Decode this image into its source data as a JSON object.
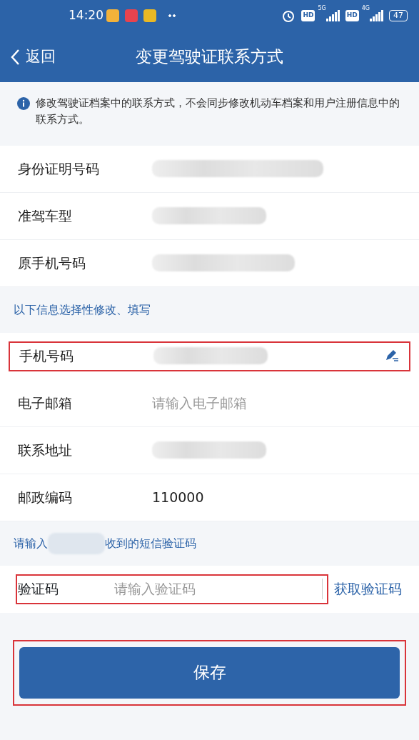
{
  "status_bar": {
    "time": "14:20",
    "hd_badges": [
      "HD",
      "HD"
    ],
    "networks": [
      "5G",
      "4G"
    ],
    "battery": "47"
  },
  "header": {
    "back_label": "返回",
    "title": "变更驾驶证联系方式"
  },
  "notice": "修改驾驶证档案中的联系方式，不会同步修改机动车档案和用户注册信息中的联系方式。",
  "info_rows": [
    {
      "label": "身份证明号码",
      "kind": "redacted",
      "highlighted": false
    },
    {
      "label": "准驾车型",
      "kind": "redacted",
      "highlighted": false
    },
    {
      "label": "原手机号码",
      "kind": "redacted",
      "highlighted": false
    }
  ],
  "section_label": "以下信息选择性修改、填写",
  "edit_rows": [
    {
      "label": "手机号码",
      "kind": "redacted",
      "highlighted": true,
      "editable": true
    },
    {
      "label": "电子邮箱",
      "kind": "input",
      "placeholder": "请输入电子邮箱",
      "highlighted": false,
      "editable": false
    },
    {
      "label": "联系地址",
      "kind": "redacted",
      "highlighted": false,
      "editable": false
    },
    {
      "label": "邮政编码",
      "kind": "text",
      "value": "110000",
      "highlighted": false,
      "editable": false
    }
  ],
  "sms_hint": {
    "prefix": "请输入",
    "suffix": "收到的短信验证码"
  },
  "code_row": {
    "label": "验证码",
    "placeholder": "请输入验证码",
    "highlighted": true,
    "button": "获取验证码"
  },
  "save": {
    "label": "保存",
    "highlighted": true
  }
}
